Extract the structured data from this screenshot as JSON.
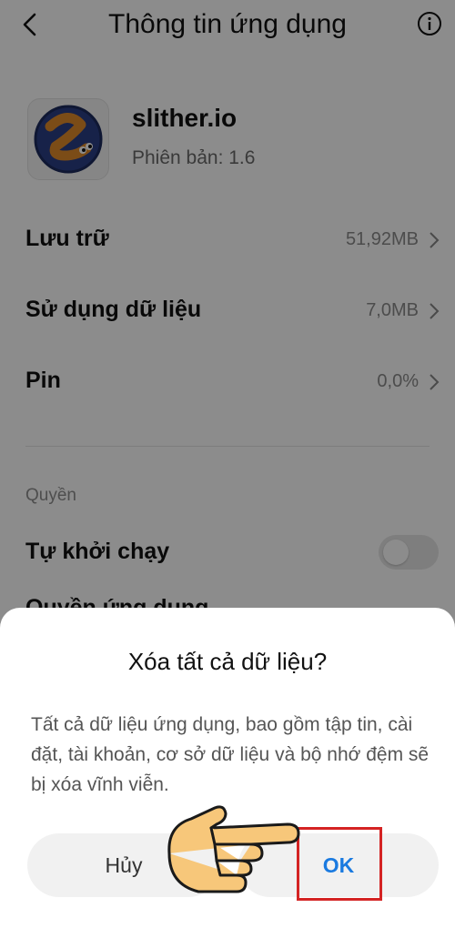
{
  "header": {
    "title": "Thông tin ứng dụng"
  },
  "app": {
    "name": "slither.io",
    "version": "Phiên bản: 1.6"
  },
  "settings_rows": [
    {
      "label": "Lưu trữ",
      "value": "51,92MB"
    },
    {
      "label": "Sử dụng dữ liệu",
      "value": "7,0MB"
    },
    {
      "label": "Pin",
      "value": "0,0%"
    }
  ],
  "permissions_section": {
    "label": "Quyền",
    "autostart_label": "Tự khởi chạy",
    "autostart_enabled": false,
    "app_permissions_label": "Quyền ứng dụng"
  },
  "dialog": {
    "title": "Xóa tất cả dữ liệu?",
    "message": "Tất cả dữ liệu ứng dụng, bao gồm tập tin, cài đặt, tài khoản, cơ sở dữ liệu và bộ nhớ đệm sẽ bị xóa vĩnh viễn.",
    "cancel_label": "Hủy",
    "ok_label": "OK"
  },
  "colors": {
    "accent": "#1a7ae0",
    "highlight_box": "#d42323",
    "overlay": "rgba(0,0,0,0.45)"
  },
  "icons": [
    "back-arrow-icon",
    "info-icon",
    "chevron-right-icon",
    "pointing-hand-icon"
  ]
}
